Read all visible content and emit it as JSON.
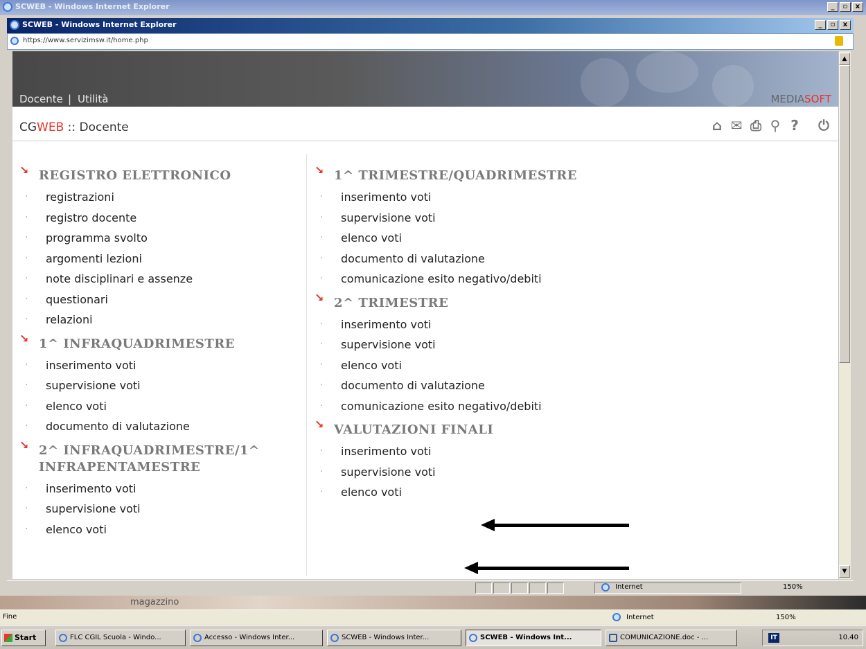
{
  "outer_window": {
    "title": "SCWEB - Windows Internet Explorer"
  },
  "inner_window": {
    "title": "SCWEB - Windows Internet Explorer",
    "address": "https://www.servizimsw.it/home.php"
  },
  "site": {
    "nav": {
      "docente": "Docente",
      "separator": "|",
      "utilita": "Utilità"
    },
    "brand": {
      "part1": "MEDIA",
      "part2": "SOFT"
    },
    "app": {
      "cg": "CG",
      "web": "WEB",
      "suffix": " :: Docente"
    },
    "toolbar_icons": [
      "home-icon",
      "mail-icon",
      "print-icon",
      "search-icon",
      "help-icon",
      "power-icon"
    ],
    "toolbar_glyphs": {
      "help": "?"
    }
  },
  "left_column": [
    {
      "title": "REGISTRO ELETTRONICO",
      "items": [
        "registrazioni",
        "registro docente",
        "programma svolto",
        "argomenti lezioni",
        "note disciplinari e assenze",
        "questionari",
        "relazioni"
      ]
    },
    {
      "title": "1^ INFRAQUADRIMESTRE",
      "items": [
        "inserimento voti",
        "supervisione voti",
        "elenco voti",
        "documento di valutazione"
      ]
    },
    {
      "title": "2^ INFRAQUADRIMESTRE/1^ INFRAPENTAMESTRE",
      "items": [
        "inserimento voti",
        "supervisione voti",
        "elenco voti"
      ]
    }
  ],
  "right_column": [
    {
      "title": "1^ TRIMESTRE/QUADRIMESTRE",
      "items": [
        "inserimento voti",
        "supervisione voti",
        "elenco voti",
        "documento di valutazione",
        "comunicazione esito negativo/debiti"
      ]
    },
    {
      "title": "2^ TRIMESTRE",
      "items": [
        "inserimento voti",
        "supervisione voti",
        "elenco voti",
        "documento di valutazione",
        "comunicazione esito negativo/debiti"
      ]
    },
    {
      "title": "VALUTAZIONI FINALI",
      "items": [
        "inserimento voti",
        "supervisione voti",
        "elenco voti"
      ]
    }
  ],
  "inner_status": {
    "zone": "Internet",
    "zoom": "150%"
  },
  "background_text": "magazzino",
  "outer_status": {
    "left": "Fine",
    "zone": "Internet",
    "zoom": "150%"
  },
  "taskbar": {
    "start": "Start",
    "tasks": [
      "FLC CGIL Scuola - Windo...",
      "Accesso - Windows Inter...",
      "SCWEB - Windows Inter...",
      "SCWEB - Windows Int...",
      "COMUNICAZIONE.doc - ..."
    ],
    "lang": "IT",
    "clock": "10.40"
  }
}
